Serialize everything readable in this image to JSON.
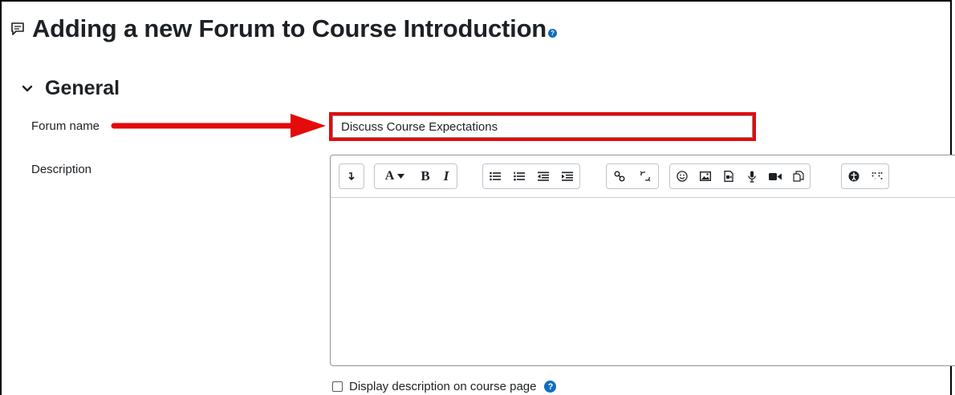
{
  "header": {
    "title": "Adding a new Forum to Course Introduction",
    "help_glyph": "?"
  },
  "section": {
    "title": "General"
  },
  "form": {
    "forum_name_label": "Forum name",
    "forum_name_value": "Discuss Course Expectations",
    "description_label": "Description",
    "display_description_label": "Display description on course page",
    "display_description_checked": false,
    "help_glyph": "?"
  },
  "toolbar": {
    "groups": [
      [
        "collapse-toggle-icon"
      ],
      [
        "font-style-dropdown-icon",
        "bold-icon",
        "italic-icon"
      ],
      [
        "unordered-list-icon",
        "ordered-list-icon",
        "outdent-icon",
        "indent-icon"
      ],
      [
        "link-icon",
        "unlink-icon"
      ],
      [
        "emoji-icon",
        "image-icon",
        "media-icon",
        "record-audio-icon",
        "record-video-icon",
        "manage-files-icon"
      ],
      [
        "accessibility-checker-icon",
        "screen-reader-helper-icon"
      ]
    ],
    "labels": {
      "font": "A",
      "bold": "B",
      "italic": "I"
    }
  },
  "annotation": {
    "arrow_color": "#e30b0b",
    "highlight_color": "#e30b0b"
  },
  "colors": {
    "accent": "#0f6cbf",
    "text": "#1d2125"
  }
}
